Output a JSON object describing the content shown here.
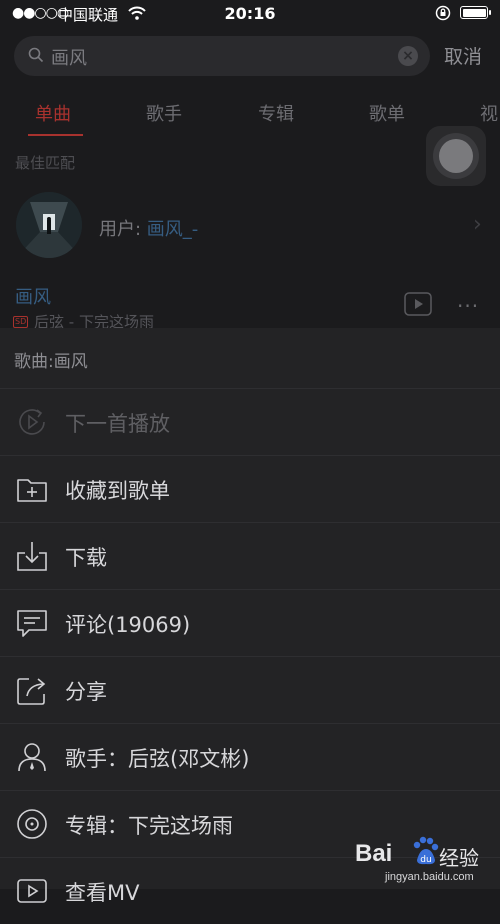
{
  "status_bar": {
    "signal": "●●○○○",
    "carrier": "中国联通",
    "time": "20:16"
  },
  "search": {
    "query": "画风",
    "cancel_label": "取消"
  },
  "tabs": [
    {
      "label": "单曲",
      "active": true
    },
    {
      "label": "歌手",
      "active": false
    },
    {
      "label": "专辑",
      "active": false
    },
    {
      "label": "歌单",
      "active": false
    },
    {
      "label": "视",
      "active": false
    }
  ],
  "best_match": {
    "label": "最佳匹配",
    "user_prefix": "用户: ",
    "user_name": "画风_-"
  },
  "song": {
    "title": "画风",
    "quality_badge": "SD",
    "artist_album": "后弦 - 下完这场雨"
  },
  "sheet": {
    "title": "歌曲:画风",
    "items": [
      {
        "label": "下一首播放",
        "icon": "play-next-icon",
        "disabled": true
      },
      {
        "label": "收藏到歌单",
        "icon": "add-folder-icon",
        "disabled": false
      },
      {
        "label": "下载",
        "icon": "download-icon",
        "disabled": false
      },
      {
        "label": "评论(19069)",
        "icon": "comment-icon",
        "disabled": false
      },
      {
        "label": "分享",
        "icon": "share-icon",
        "disabled": false
      },
      {
        "label": "歌手：后弦(邓文彬)",
        "icon": "singer-icon",
        "disabled": false
      },
      {
        "label": "专辑：下完这场雨",
        "icon": "album-icon",
        "disabled": false
      },
      {
        "label": "查看MV",
        "icon": "mv-icon",
        "disabled": false
      }
    ]
  },
  "watermark": {
    "brand_left": "Bai",
    "brand_right": "经验",
    "url": "jingyan.baidu.com"
  },
  "colors": {
    "accent": "#a8322e",
    "link": "#365d82",
    "background": "#1b1b1d",
    "sheet": "#232325"
  }
}
